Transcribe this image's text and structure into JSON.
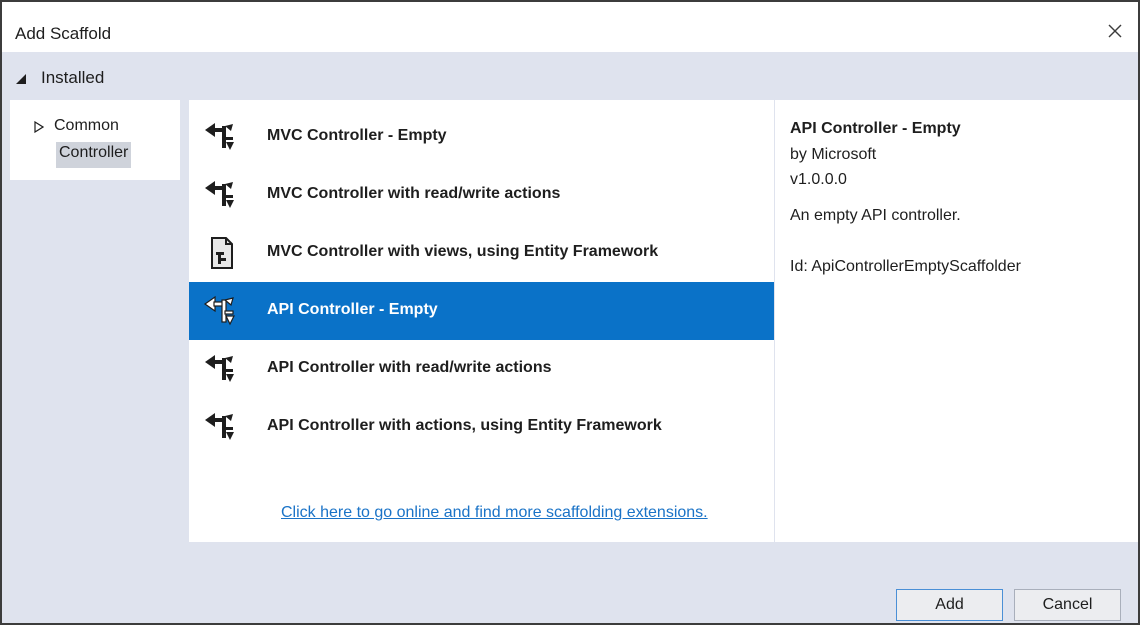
{
  "window": {
    "title": "Add Scaffold"
  },
  "category_bar": {
    "label": "Installed"
  },
  "tree": {
    "items": [
      {
        "label": "Common",
        "expandable": true
      },
      {
        "label": "Controller",
        "selected": true
      }
    ]
  },
  "list": {
    "items": [
      {
        "label": "MVC Controller - Empty",
        "icon": "controller-icon",
        "selected": false
      },
      {
        "label": "MVC Controller with read/write actions",
        "icon": "controller-icon",
        "selected": false
      },
      {
        "label": "MVC Controller with views, using Entity Framework",
        "icon": "entity-framework-icon",
        "selected": false
      },
      {
        "label": "API Controller - Empty",
        "icon": "controller-icon",
        "selected": true
      },
      {
        "label": "API Controller with read/write actions",
        "icon": "controller-icon",
        "selected": false
      },
      {
        "label": "API Controller with actions, using Entity Framework",
        "icon": "controller-icon",
        "selected": false
      }
    ],
    "online_link": "Click here to go online and find more scaffolding extensions."
  },
  "details": {
    "title": "API Controller - Empty",
    "author": "by Microsoft",
    "version": "v1.0.0.0",
    "description": "An empty API controller.",
    "id": "Id: ApiControllerEmptyScaffolder"
  },
  "buttons": {
    "add": "Add",
    "cancel": "Cancel"
  },
  "colors": {
    "selection": "#0a72c8",
    "chrome": "#dfe3ee",
    "link": "#1a73c7",
    "tree_selection": "#cfd3db"
  }
}
